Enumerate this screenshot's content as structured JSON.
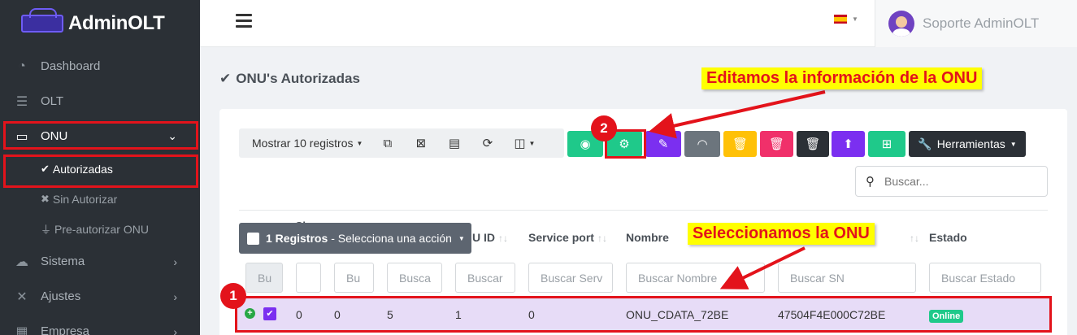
{
  "brand": {
    "name": "AdminOLT"
  },
  "sidebar": {
    "items": [
      {
        "label": "Dashboard",
        "icon": "gauge-icon"
      },
      {
        "label": "OLT",
        "icon": "server-icon"
      },
      {
        "label": "ONU",
        "icon": "router-icon"
      },
      {
        "label": "Sistema",
        "icon": "cloud-icon"
      },
      {
        "label": "Ajustes",
        "icon": "tools-icon"
      },
      {
        "label": "Empresa",
        "icon": "building-icon"
      }
    ],
    "onu_sub": [
      {
        "label": "Autorizadas",
        "icon": "check-icon"
      },
      {
        "label": "Sin Autorizar",
        "icon": "x-icon"
      },
      {
        "label": "Pre-autorizar ONU",
        "icon": "plug-icon"
      }
    ]
  },
  "topbar": {
    "user_name": "Soporte AdminOLT",
    "language": "es"
  },
  "page": {
    "title": "ONU's Autorizadas"
  },
  "toolbar": {
    "show_label": "Mostrar 10 registros",
    "tools_label": "Herramientas",
    "action_colors": {
      "view": "#1fc98a",
      "config": "#1fc98a",
      "edit": "#7b2ff0",
      "wifi": "#6c757d",
      "delete_yellow": "#ffc107",
      "delete_pink": "#f0306a",
      "delete_dark": "#2b3036",
      "upload": "#7b2ff0",
      "network": "#1fc98a"
    }
  },
  "search": {
    "placeholder": "Buscar..."
  },
  "selection": {
    "count_label": "1 Registros",
    "action_label": "- Selecciona una acción"
  },
  "table": {
    "headers": {
      "onu_id": "U ID",
      "service_port": "Service port",
      "nombre": "Nombre",
      "estado": "Estado",
      "ch": "Ch"
    },
    "filters": {
      "f1": "Bu",
      "f2": "",
      "f3": "Bu",
      "f4": "Busca",
      "f5": "Buscar",
      "service_port": "Buscar Serv",
      "nombre": "Buscar Nombre",
      "sn": "Buscar SN",
      "estado": "Buscar Estado"
    },
    "rows": [
      {
        "c1": "0",
        "c2": "0",
        "c3": "5",
        "onu_id": "1",
        "service_port": "0",
        "nombre": "ONU_CDATA_72BE",
        "sn": "47504F4E000C72BE",
        "estado": "Online"
      }
    ]
  },
  "annotations": {
    "edit_callout": "Editamos la información de la ONU",
    "select_callout": "Seleccionamos la ONU",
    "step1": "1",
    "step2": "2"
  }
}
